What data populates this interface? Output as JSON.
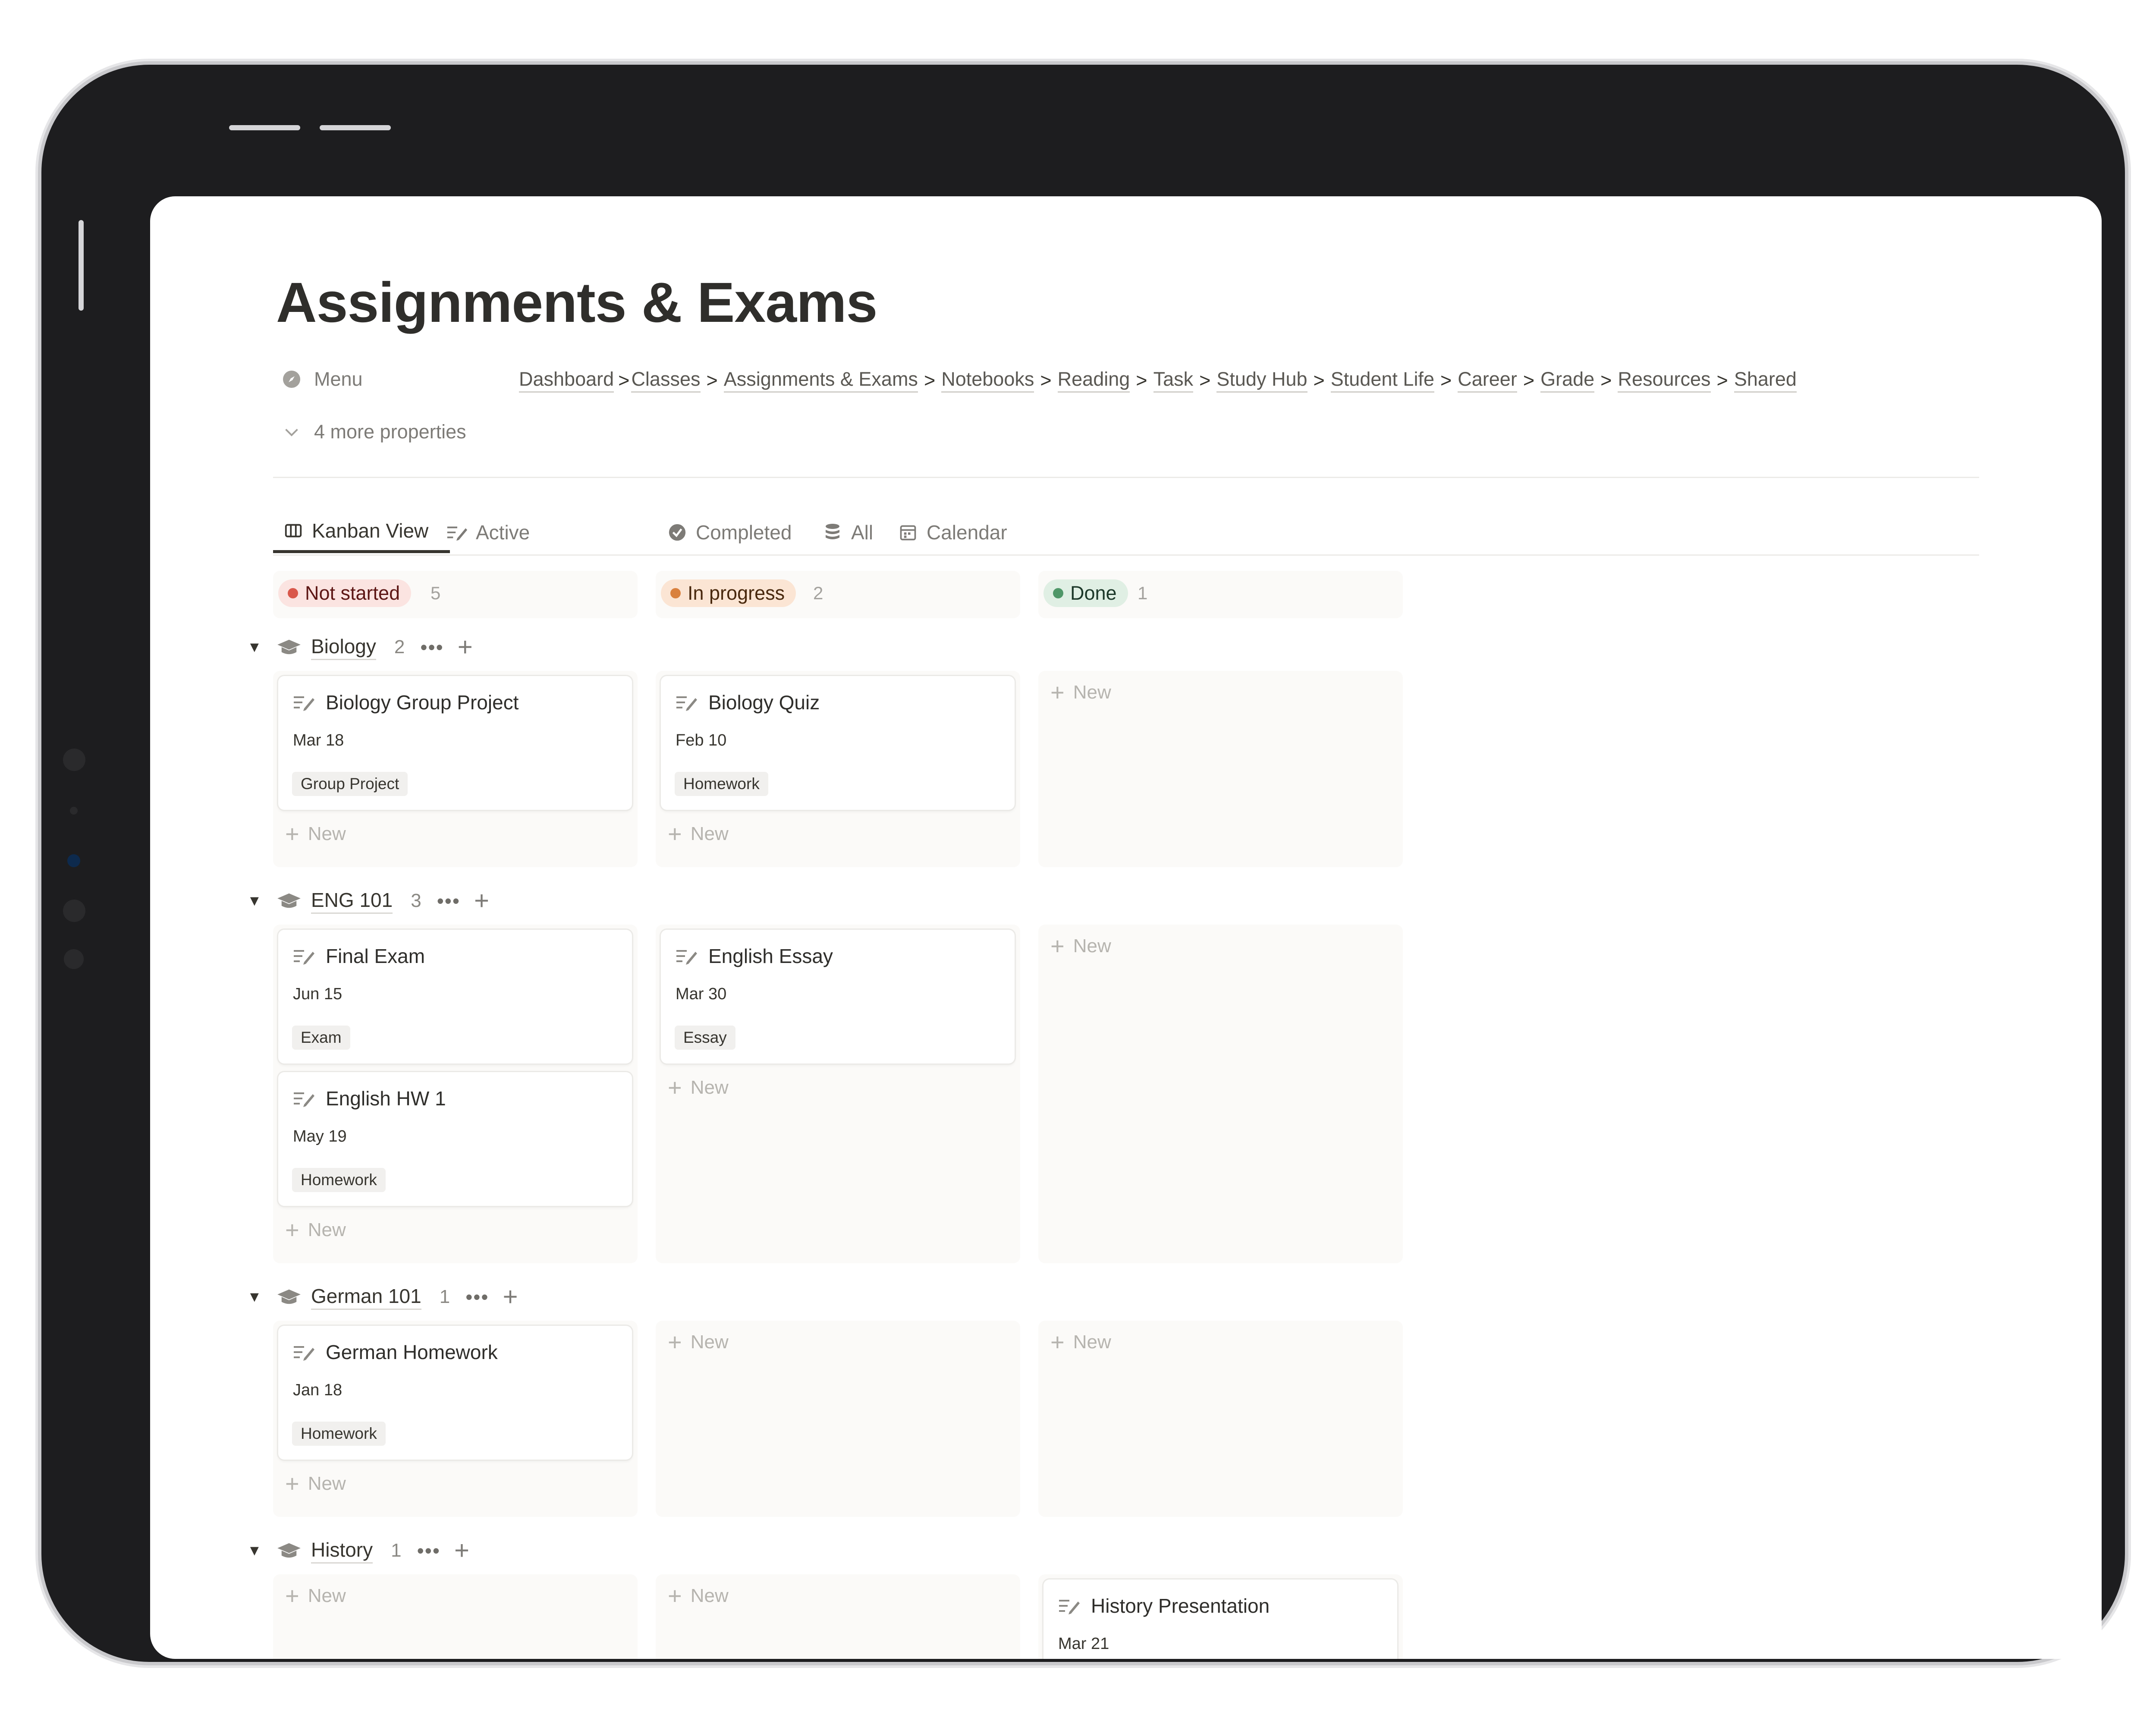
{
  "page": {
    "title": "Assignments & Exams",
    "menu_label": "Menu",
    "more_properties": "4 more properties"
  },
  "breadcrumb": [
    "Dashboard",
    "Classes",
    "Assignments & Exams",
    "Notebooks",
    "Reading",
    "Task",
    "Study Hub",
    "Student Life",
    "Career",
    "Grade",
    "Resources",
    "Shared"
  ],
  "tabs": [
    {
      "label": "Kanban View",
      "icon": "board-icon",
      "active": true
    },
    {
      "label": "Active",
      "icon": "task-edit-icon",
      "active": false
    },
    {
      "label": "Completed",
      "icon": "check-circle-icon",
      "active": false
    },
    {
      "label": "All",
      "icon": "database-icon",
      "active": false
    },
    {
      "label": "Calendar",
      "icon": "calendar-icon",
      "active": false
    }
  ],
  "columns": [
    {
      "label": "Not started",
      "count": "5",
      "bg": "#fbe4e1",
      "dot": "#d9584b",
      "text": "#5d1715"
    },
    {
      "label": "In progress",
      "count": "2",
      "bg": "#fbe5d4",
      "dot": "#d9813e",
      "text": "#49290e"
    },
    {
      "label": "Done",
      "count": "1",
      "bg": "#e0efe4",
      "dot": "#4f9768",
      "text": "#1c3829"
    }
  ],
  "new_label": "New",
  "more_glyph": "•••",
  "plus_glyph": "+",
  "groups": [
    {
      "name": "Biology",
      "count": "2",
      "cards": [
        {
          "title": "Biology Group Project",
          "date": "Mar 18",
          "tag": "Group Project"
        },
        {
          "title": "Biology Quiz",
          "date": "Feb 10",
          "tag": "Homework"
        }
      ]
    },
    {
      "name": "ENG 101",
      "count": "3",
      "cards": [
        {
          "title": "Final Exam",
          "date": "Jun 15",
          "tag": "Exam"
        },
        {
          "title": "English HW 1",
          "date": "May 19",
          "tag": "Homework"
        },
        {
          "title": "English Essay",
          "date": "Mar 30",
          "tag": "Essay"
        }
      ]
    },
    {
      "name": "German 101",
      "count": "1",
      "cards": [
        {
          "title": "German Homework",
          "date": "Jan 18",
          "tag": "Homework"
        }
      ]
    },
    {
      "name": "History",
      "count": "1",
      "cards": [
        {
          "title": "History Presentation",
          "date": "Mar 21"
        }
      ]
    }
  ],
  "colors": {
    "text": "#37352f",
    "muted": "#7d7b77",
    "lane_bg": "#fbfaf8",
    "tag_bg": "#f1f0ee",
    "frame": "#1d1d1f"
  }
}
